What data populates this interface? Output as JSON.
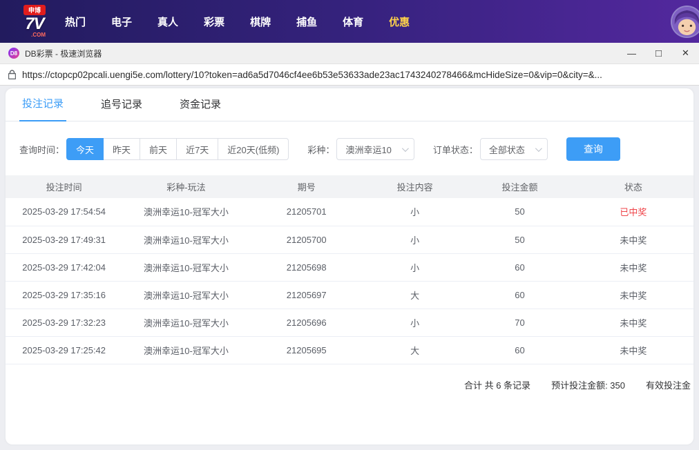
{
  "site_header": {
    "logo": {
      "badge": "申博",
      "name": "7V",
      "suffix": ".COM"
    },
    "nav_items": [
      {
        "label": "热门",
        "active": false
      },
      {
        "label": "电子",
        "active": false
      },
      {
        "label": "真人",
        "active": false
      },
      {
        "label": "彩票",
        "active": false
      },
      {
        "label": "棋牌",
        "active": false
      },
      {
        "label": "捕鱼",
        "active": false
      },
      {
        "label": "体育",
        "active": false
      },
      {
        "label": "优惠",
        "active": true
      }
    ]
  },
  "browser": {
    "tab_icon": "D8",
    "title": "DB彩票 - 极速浏览器",
    "controls": {
      "minimize": "—",
      "maximize": "□",
      "close": "✕"
    },
    "url": "https://ctopcp02pcali.uengi5e.com/lottery/10?token=ad6a5d7046cf4ee6b53e53633ade23ac1743240278466&mcHideSize=0&vip=0&city=&..."
  },
  "page": {
    "tabs": [
      {
        "label": "投注记录",
        "active": true
      },
      {
        "label": "追号记录",
        "active": false
      },
      {
        "label": "资金记录",
        "active": false
      }
    ],
    "filters": {
      "time_label": "查询时间：",
      "time_options": [
        {
          "label": "今天",
          "active": true
        },
        {
          "label": "昨天",
          "active": false
        },
        {
          "label": "前天",
          "active": false
        },
        {
          "label": "近7天",
          "active": false
        },
        {
          "label": "近20天(低频)",
          "active": false
        }
      ],
      "lottery_label": "彩种：",
      "lottery_value": "澳洲幸运10",
      "status_label": "订单状态：",
      "status_value": "全部状态",
      "search_button": "查询"
    },
    "table": {
      "headers": [
        "投注时间",
        "彩种-玩法",
        "期号",
        "投注内容",
        "投注金额",
        "状态"
      ],
      "rows": [
        {
          "time": "2025-03-29 17:54:54",
          "game": "澳洲幸运10-冠军大小",
          "issue": "21205701",
          "content": "小",
          "amount": "50",
          "status": "已中奖",
          "won": true
        },
        {
          "time": "2025-03-29 17:49:31",
          "game": "澳洲幸运10-冠军大小",
          "issue": "21205700",
          "content": "小",
          "amount": "50",
          "status": "未中奖",
          "won": false
        },
        {
          "time": "2025-03-29 17:42:04",
          "game": "澳洲幸运10-冠军大小",
          "issue": "21205698",
          "content": "小",
          "amount": "60",
          "status": "未中奖",
          "won": false
        },
        {
          "time": "2025-03-29 17:35:16",
          "game": "澳洲幸运10-冠军大小",
          "issue": "21205697",
          "content": "大",
          "amount": "60",
          "status": "未中奖",
          "won": false
        },
        {
          "time": "2025-03-29 17:32:23",
          "game": "澳洲幸运10-冠军大小",
          "issue": "21205696",
          "content": "小",
          "amount": "70",
          "status": "未中奖",
          "won": false
        },
        {
          "time": "2025-03-29 17:25:42",
          "game": "澳洲幸运10-冠军大小",
          "issue": "21205695",
          "content": "大",
          "amount": "60",
          "status": "未中奖",
          "won": false
        }
      ]
    },
    "summary": {
      "total": "合计 共 6 条记录",
      "expected": "预计投注金额: 350",
      "valid": "有效投注金"
    }
  }
}
